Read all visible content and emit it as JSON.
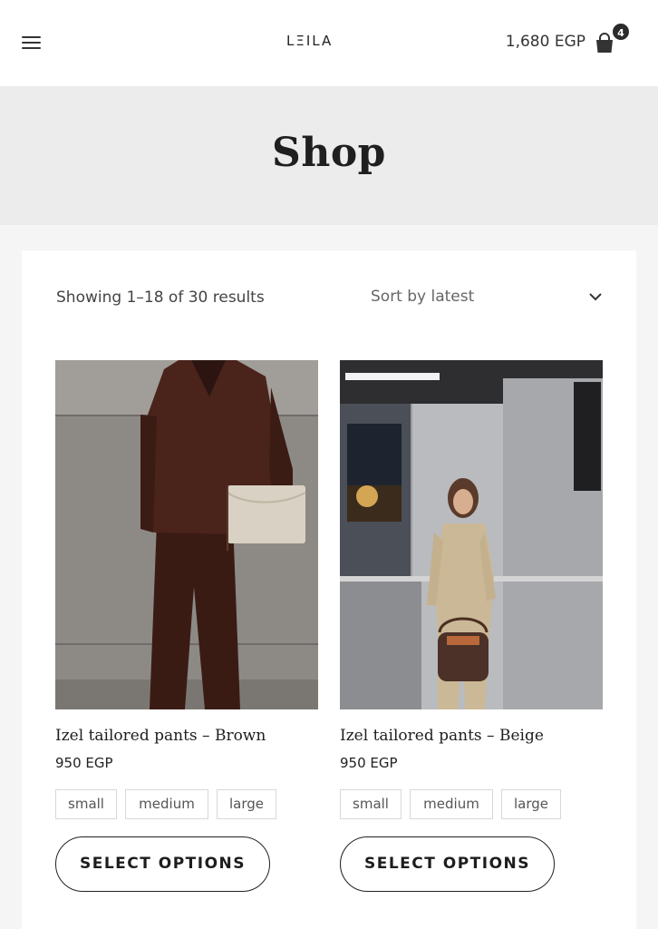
{
  "header": {
    "logo_text": "LΞILA",
    "cart_total": "1,680 EGP",
    "cart_count": "4",
    "icons": {
      "menu": "hamburger-menu-icon",
      "cart": "shopping-bag-icon"
    }
  },
  "hero": {
    "title": "Shop"
  },
  "toolbar": {
    "result_count": "Showing 1–18 of 30 results",
    "sort_label": "Sort by latest"
  },
  "products": [
    {
      "title": "Izel tailored pants – Brown",
      "price": "950 EGP",
      "sizes": [
        "small",
        "medium",
        "large"
      ],
      "button": "SELECT OPTIONS"
    },
    {
      "title": "Izel tailored pants – Beige",
      "price": "950 EGP",
      "sizes": [
        "small",
        "medium",
        "large"
      ],
      "button": "SELECT OPTIONS"
    }
  ],
  "colors": {
    "accent": "#222222",
    "hero_bg": "#ececec",
    "page_bg": "#f5f5f5"
  }
}
